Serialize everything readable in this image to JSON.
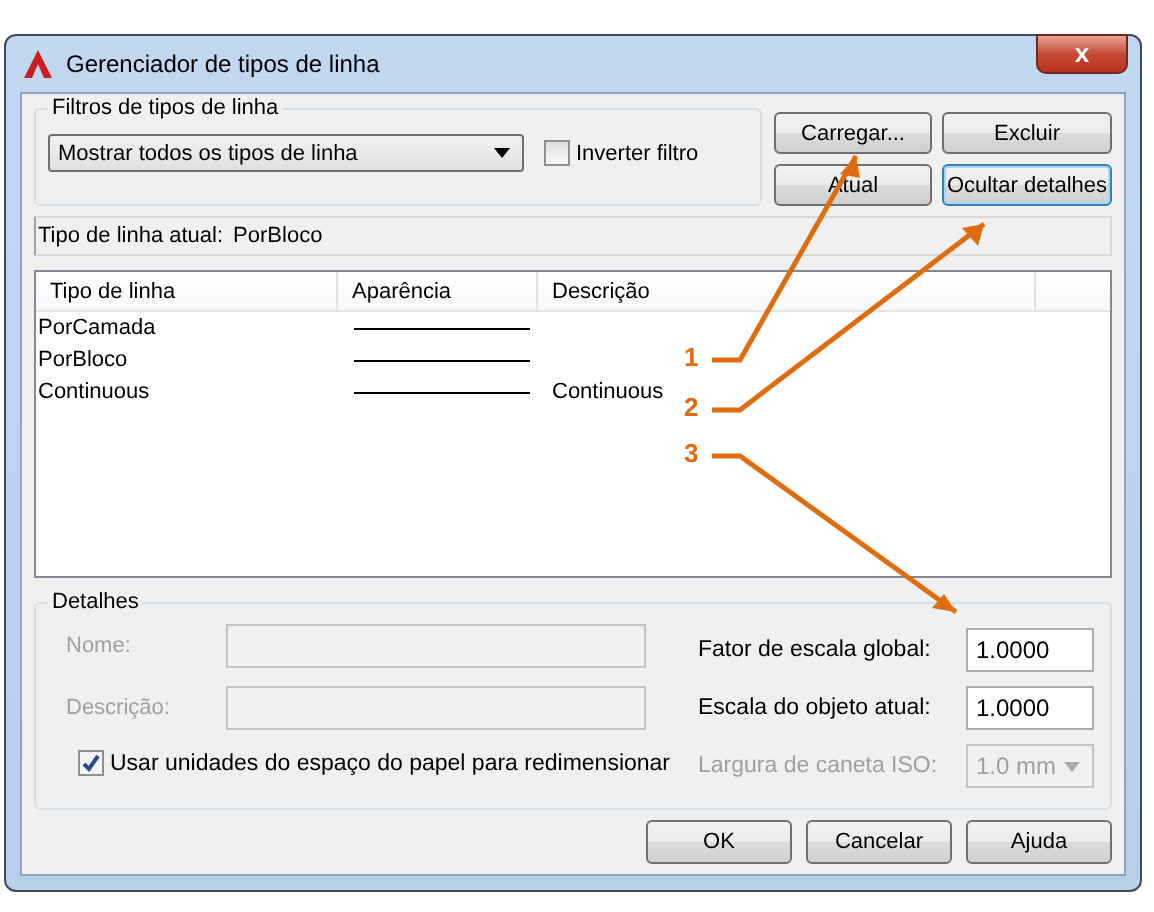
{
  "window": {
    "title": "Gerenciador de tipos de linha",
    "close_symbol": "x"
  },
  "filters": {
    "legend": "Filtros de tipos de linha",
    "dropdown": {
      "value": "Mostrar todos os tipos de linha"
    },
    "invert": {
      "label": "Inverter filtro",
      "checked": false
    }
  },
  "top_buttons": [
    {
      "label": "Carregar...",
      "focused": false
    },
    {
      "label": "Excluir",
      "focused": false
    },
    {
      "label": "Atual",
      "focused": false
    },
    {
      "label": "Ocultar detalhes",
      "focused": true
    }
  ],
  "current": {
    "label": "Tipo de linha atual:",
    "value": "PorBloco"
  },
  "table": {
    "columns": [
      "Tipo de linha",
      "Aparência",
      "Descrição"
    ],
    "rows": [
      {
        "name": "PorCamada"
      },
      {
        "name": "PorBloco"
      },
      {
        "name": "Continuous",
        "description": "Continuous"
      }
    ]
  },
  "details": {
    "legend": "Detalhes",
    "left_fields": [
      {
        "label": "Nome:",
        "disabled": true
      },
      {
        "label": "Descrição:",
        "disabled": true
      }
    ],
    "checkbox": {
      "label": "Usar unidades do espaço do papel para redimensionar",
      "checked": true
    },
    "right_fields": [
      {
        "kind": "input",
        "label": "Fator de escala global:",
        "value": "1.0000",
        "disabled": false
      },
      {
        "kind": "input",
        "label": "Escala do objeto atual:",
        "value": "1.0000",
        "disabled": false
      },
      {
        "kind": "select",
        "label": "Largura de caneta ISO:",
        "value": "1.0 mm",
        "disabled": true
      }
    ]
  },
  "bottom_buttons": [
    "OK",
    "Cancelar",
    "Ajuda"
  ],
  "callouts": [
    {
      "label": "1"
    },
    {
      "label": "2"
    },
    {
      "label": "3"
    }
  ]
}
